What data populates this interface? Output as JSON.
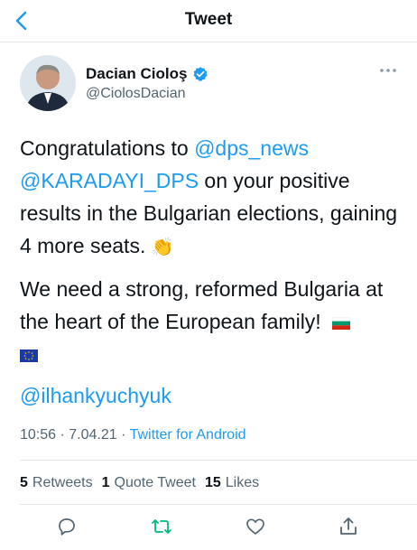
{
  "header": {
    "title": "Tweet"
  },
  "author": {
    "name": "Dacian Cioloş",
    "handle": "@CiolosDacian"
  },
  "tweet": {
    "para1": {
      "text_a": "Congratulations to ",
      "mention1": "@dps_news",
      "mention2": "@KARADAYI_DPS",
      "text_b": " on your positive results in the Bulgarian elections, gaining 4 more seats. ",
      "emoji": "👏"
    },
    "para2": {
      "text": "We need a strong, reformed Bulgaria at the heart of the European family! "
    },
    "para3": {
      "mention": "@ilhankyuchyuk"
    }
  },
  "meta": {
    "time": "10:56 · 7.04.21 · ",
    "source": "Twitter for Android"
  },
  "stats": {
    "retweets_count": "5",
    "retweets_label": "Retweets",
    "quotes_count": "1",
    "quotes_label": "Quote Tweet",
    "likes_count": "15",
    "likes_label": "Likes"
  },
  "colors": {
    "accent": "#1d9bf0",
    "retweet": "#00ba7c",
    "text": "#0f1419",
    "muted": "#536471"
  },
  "icons": [
    "back-arrow-icon",
    "verified-badge-icon",
    "more-icon",
    "reply-icon",
    "retweet-icon",
    "like-icon",
    "share-icon"
  ]
}
